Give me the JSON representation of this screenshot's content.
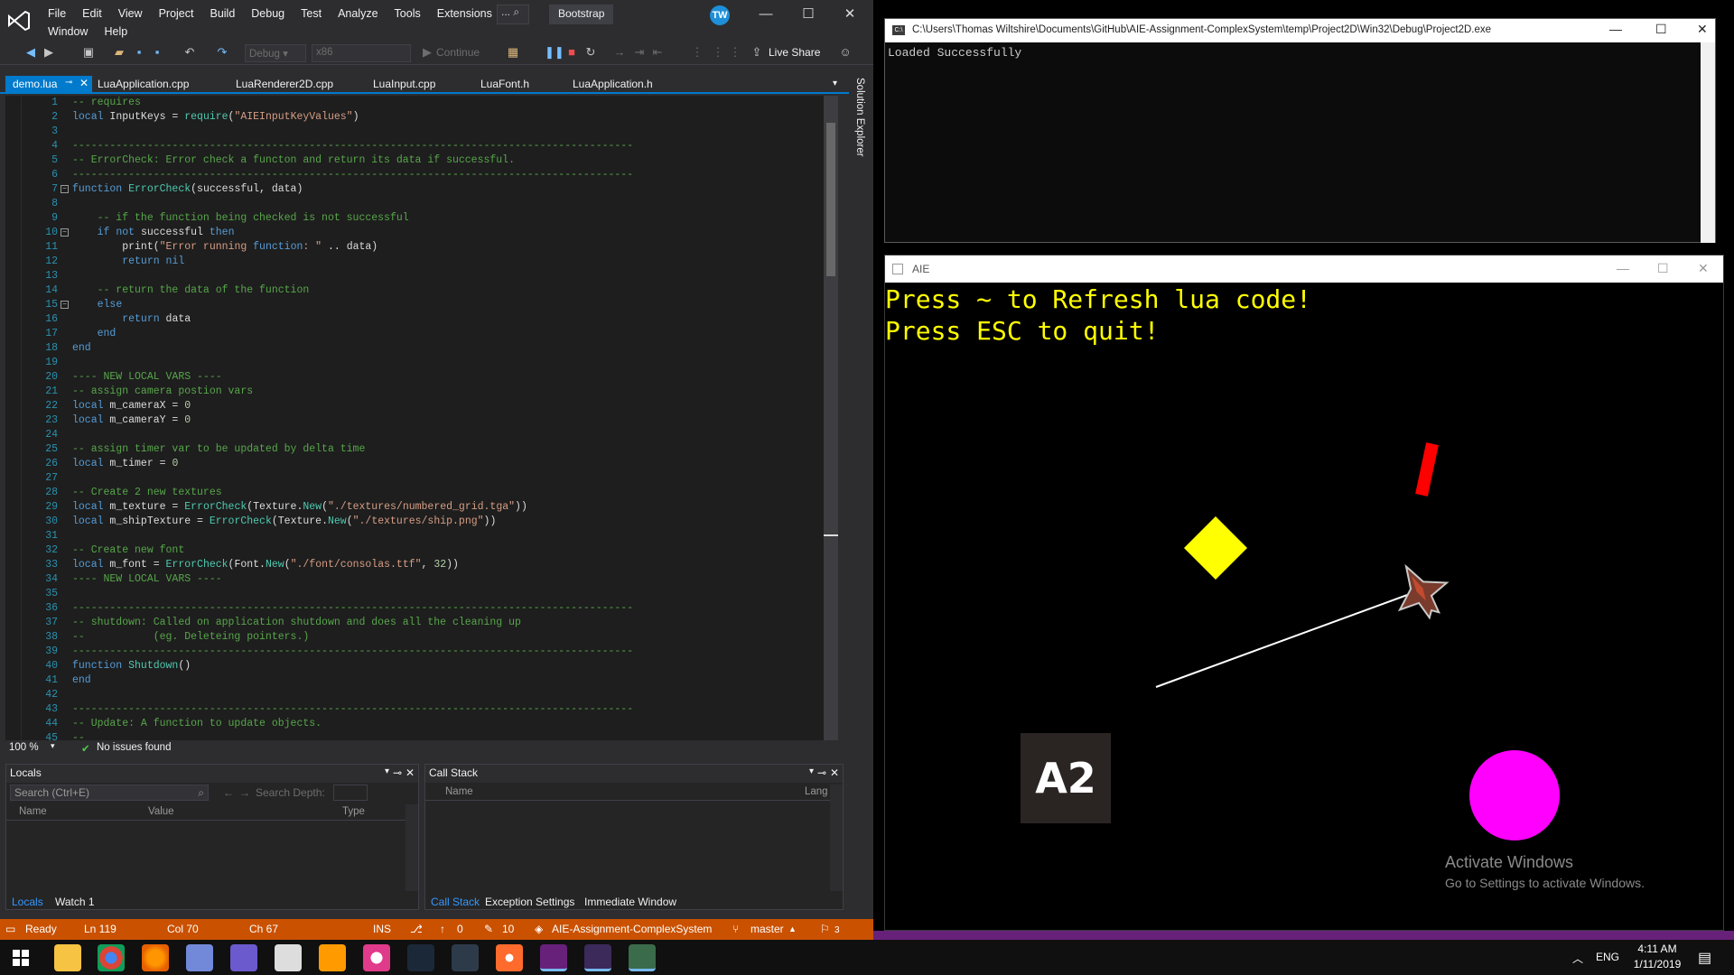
{
  "vs": {
    "menu_row1": [
      "File",
      "Edit",
      "View",
      "Project",
      "Build",
      "Debug",
      "Test",
      "Analyze",
      "Tools",
      "Extensions"
    ],
    "menu_row2": [
      "Window",
      "Help"
    ],
    "quick_launch": "...",
    "bootstrap": "Bootstrap",
    "avatar": "TW",
    "toolbar": {
      "config": "Debug",
      "platform": "x86",
      "continue": "Continue",
      "live_share": "Live Share"
    },
    "tabs": [
      "demo.lua",
      "LuaApplication.cpp",
      "LuaRenderer2D.cpp",
      "LuaInput.cpp",
      "LuaFont.h",
      "LuaApplication.h"
    ],
    "solution_explorer": "Solution Explorer",
    "code_lines": [
      {
        "n": "1",
        "t": "-- requires",
        "k": "cm"
      },
      {
        "n": "2",
        "t": "local InputKeys = require(\"AIEInputKeyValues\")",
        "k": "code"
      },
      {
        "n": "3",
        "t": "",
        "k": "code"
      },
      {
        "n": "4",
        "t": "------------------------------------------------------------------------------------------",
        "k": "cm"
      },
      {
        "n": "5",
        "t": "-- ErrorCheck: Error check a functon and return its data if successful.",
        "k": "cm"
      },
      {
        "n": "6",
        "t": "------------------------------------------------------------------------------------------",
        "k": "cm"
      },
      {
        "n": "7",
        "t": "function ErrorCheck(successful, data)",
        "k": "code"
      },
      {
        "n": "8",
        "t": "",
        "k": "code"
      },
      {
        "n": "9",
        "t": "    -- if the function being checked is not successful",
        "k": "cm"
      },
      {
        "n": "10",
        "t": "    if not successful then",
        "k": "code"
      },
      {
        "n": "11",
        "t": "        print(\"Error running function: \" .. data)",
        "k": "code"
      },
      {
        "n": "12",
        "t": "        return nil",
        "k": "code"
      },
      {
        "n": "13",
        "t": "",
        "k": "code"
      },
      {
        "n": "14",
        "t": "    -- return the data of the function",
        "k": "cm"
      },
      {
        "n": "15",
        "t": "    else",
        "k": "code"
      },
      {
        "n": "16",
        "t": "        return data",
        "k": "code"
      },
      {
        "n": "17",
        "t": "    end",
        "k": "code"
      },
      {
        "n": "18",
        "t": "end",
        "k": "code"
      },
      {
        "n": "19",
        "t": "",
        "k": "code"
      },
      {
        "n": "20",
        "t": "---- NEW LOCAL VARS ----",
        "k": "cm"
      },
      {
        "n": "21",
        "t": "-- assign camera postion vars",
        "k": "cm"
      },
      {
        "n": "22",
        "t": "local m_cameraX = 0",
        "k": "code"
      },
      {
        "n": "23",
        "t": "local m_cameraY = 0",
        "k": "code"
      },
      {
        "n": "24",
        "t": "",
        "k": "code"
      },
      {
        "n": "25",
        "t": "-- assign timer var to be updated by delta time",
        "k": "cm"
      },
      {
        "n": "26",
        "t": "local m_timer = 0",
        "k": "code"
      },
      {
        "n": "27",
        "t": "",
        "k": "code"
      },
      {
        "n": "28",
        "t": "-- Create 2 new textures",
        "k": "cm"
      },
      {
        "n": "29",
        "t": "local m_texture = ErrorCheck(Texture.New(\"./textures/numbered_grid.tga\"))",
        "k": "code"
      },
      {
        "n": "30",
        "t": "local m_shipTexture = ErrorCheck(Texture.New(\"./textures/ship.png\"))",
        "k": "code"
      },
      {
        "n": "31",
        "t": "",
        "k": "code"
      },
      {
        "n": "32",
        "t": "-- Create new font",
        "k": "cm"
      },
      {
        "n": "33",
        "t": "local m_font = ErrorCheck(Font.New(\"./font/consolas.ttf\", 32))",
        "k": "code"
      },
      {
        "n": "34",
        "t": "---- NEW LOCAL VARS ----",
        "k": "cm"
      },
      {
        "n": "35",
        "t": "",
        "k": "code"
      },
      {
        "n": "36",
        "t": "------------------------------------------------------------------------------------------",
        "k": "cm"
      },
      {
        "n": "37",
        "t": "-- shutdown: Called on application shutdown and does all the cleaning up",
        "k": "cm"
      },
      {
        "n": "38",
        "t": "--           (eg. Deleteing pointers.)",
        "k": "cm"
      },
      {
        "n": "39",
        "t": "------------------------------------------------------------------------------------------",
        "k": "cm"
      },
      {
        "n": "40",
        "t": "function Shutdown()",
        "k": "code"
      },
      {
        "n": "41",
        "t": "end",
        "k": "code"
      },
      {
        "n": "42",
        "t": "",
        "k": "code"
      },
      {
        "n": "43",
        "t": "------------------------------------------------------------------------------------------",
        "k": "cm"
      },
      {
        "n": "44",
        "t": "-- Update: A function to update objects.",
        "k": "cm"
      },
      {
        "n": "45",
        "t": "--",
        "k": "cm"
      }
    ],
    "editor_status": {
      "zoom": "100 %",
      "issues": "No issues found"
    },
    "locals_panel": {
      "title": "Locals",
      "search_placeholder": "Search (Ctrl+E)",
      "search_depth": "Search Depth:",
      "col_name": "Name",
      "col_value": "Value",
      "col_type": "Type",
      "tabs": [
        "Locals",
        "Watch 1"
      ]
    },
    "callstack_panel": {
      "title": "Call Stack",
      "col_name": "Name",
      "col_lang": "Lang",
      "tabs": [
        "Call Stack",
        "Exception Settings",
        "Immediate Window"
      ]
    },
    "statusbar": {
      "ready": "Ready",
      "ln": "Ln 119",
      "col": "Col 70",
      "ch": "Ch 67",
      "ins": "INS",
      "up": "0",
      "edits": "10",
      "repo": "AIE-Assignment-ComplexSystem",
      "branch": "master",
      "notif": "3"
    }
  },
  "console": {
    "title": "C:\\Users\\Thomas Wiltshire\\Documents\\GitHub\\AIE-Assignment-ComplexSystem\\temp\\Project2D\\Win32\\Debug\\Project2D.exe",
    "output": "Loaded Successfully"
  },
  "game": {
    "title": "AIE",
    "line1": "Press ~ to Refresh lua code!",
    "line2": "Press ESC to quit!",
    "badge": "A2",
    "activate_title": "Activate Windows",
    "activate_sub": "Go to Settings to activate Windows."
  },
  "taskbar": {
    "lang": "ENG",
    "time": "4:11 AM",
    "date": "1/11/2019"
  },
  "colors": {
    "accent": "#007acc",
    "statusbar": "#ca5100",
    "game_text": "#ffff00",
    "magenta": "#ff00ff",
    "red": "#ff0000"
  }
}
